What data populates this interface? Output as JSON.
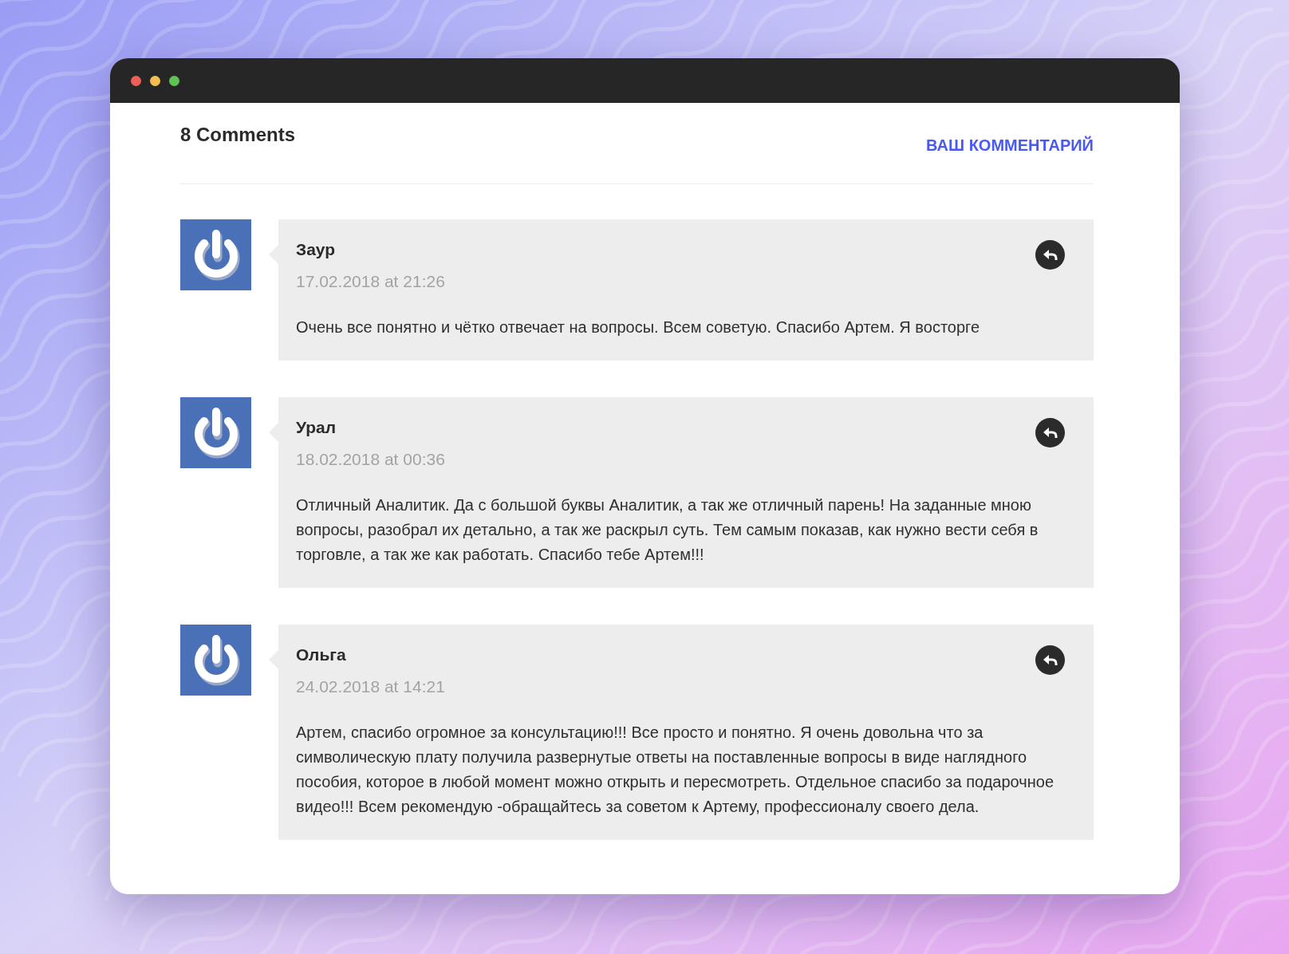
{
  "window": {
    "controls": [
      {
        "color": "#ed5f57"
      },
      {
        "color": "#f4bd4f"
      },
      {
        "color": "#5fc454"
      }
    ]
  },
  "header": {
    "title": "8 Comments",
    "link": "ВАШ КОММЕНТАРИЙ"
  },
  "comments": [
    {
      "author": "Заур",
      "date": "17.02.2018 at 21:26",
      "text": "Очень все понятно и чётко отвечает на вопросы. Всем советую. Спасибо Артем. Я восторге"
    },
    {
      "author": "Урал",
      "date": "18.02.2018 at 00:36",
      "text": "Отличный Аналитик. Да с большой буквы Аналитик, а так же отличный парень! На заданные мною вопросы, разобрал их детально, а так же раскрыл суть. Тем самым показав, как нужно вести себя в торговле, а так же как работать. Спасибо тебе Артем!!!"
    },
    {
      "author": "Ольга",
      "date": "24.02.2018 at 14:21",
      "text": "Артем, спасибо огромное за консультацию!!! Все просто и понятно. Я очень довольна что за символическую плату получила развернутые ответы на поставленные вопросы в виде наглядного пособия, которое в любой момент можно открыть и пересмотреть. Отдельное спасибо за подарочное видео!!! Всем рекомендую -обращайтесь за советом к Артему, профессионалу своего дела."
    }
  ]
}
